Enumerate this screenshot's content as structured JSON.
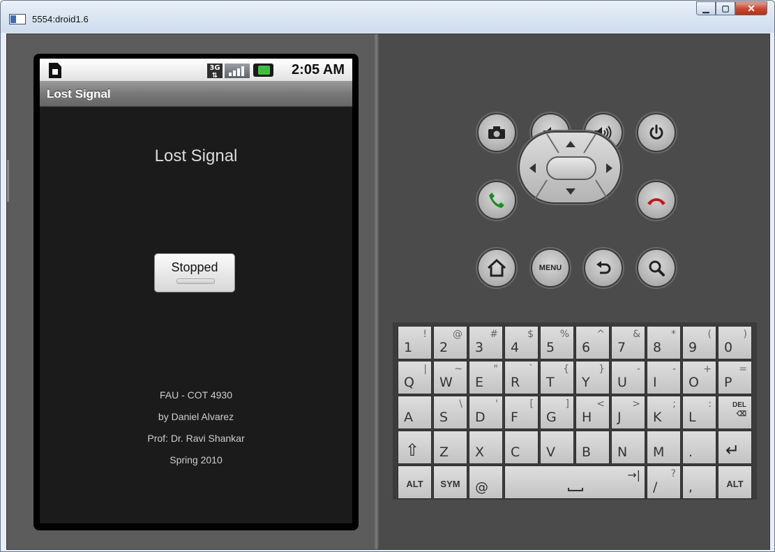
{
  "window": {
    "title": "5554:droid1.6",
    "min_glyph": "▁",
    "max_glyph": "▢",
    "close_glyph": "✕"
  },
  "status_bar": {
    "network": "3G",
    "time": "2:05 AM"
  },
  "app": {
    "bar_title": "Lost Signal",
    "heading": "Lost Signal",
    "toggle_label": "Stopped",
    "credits": [
      "FAU - COT 4930",
      "by Daniel Alvarez",
      "Prof: Dr. Ravi Shankar",
      "Spring 2010"
    ]
  },
  "controls": {
    "menu_label": "MENU",
    "icons": [
      "camera-icon",
      "volume-down-icon",
      "volume-up-icon",
      "power-icon",
      "call-icon",
      "end-call-icon",
      "home-icon",
      "back-icon",
      "search-icon"
    ]
  },
  "keyboard": {
    "rows": [
      [
        {
          "k": "1",
          "a": "!"
        },
        {
          "k": "2",
          "a": "@"
        },
        {
          "k": "3",
          "a": "#"
        },
        {
          "k": "4",
          "a": "$"
        },
        {
          "k": "5",
          "a": "%"
        },
        {
          "k": "6",
          "a": "^"
        },
        {
          "k": "7",
          "a": "&"
        },
        {
          "k": "8",
          "a": "*"
        },
        {
          "k": "9",
          "a": "("
        },
        {
          "k": "0",
          "a": ")"
        }
      ],
      [
        {
          "k": "Q",
          "a": "|"
        },
        {
          "k": "W",
          "a": "~"
        },
        {
          "k": "E",
          "a": "\""
        },
        {
          "k": "R",
          "a": "`"
        },
        {
          "k": "T",
          "a": "{"
        },
        {
          "k": "Y",
          "a": "}"
        },
        {
          "k": "U",
          "a": "-"
        },
        {
          "k": "I",
          "a": "-"
        },
        {
          "k": "O",
          "a": "+"
        },
        {
          "k": "P",
          "a": "="
        }
      ],
      [
        {
          "k": "A",
          "a": ""
        },
        {
          "k": "S",
          "a": "\\"
        },
        {
          "k": "D",
          "a": "'"
        },
        {
          "k": "F",
          "a": "["
        },
        {
          "k": "G",
          "a": "]"
        },
        {
          "k": "H",
          "a": "<"
        },
        {
          "k": "J",
          "a": ">"
        },
        {
          "k": "K",
          "a": ";"
        },
        {
          "k": "L",
          "a": ":"
        },
        {
          "k": "DEL",
          "a": ""
        }
      ],
      [
        {
          "k": "⇧",
          "a": ""
        },
        {
          "k": "Z",
          "a": ""
        },
        {
          "k": "X",
          "a": ""
        },
        {
          "k": "C",
          "a": ""
        },
        {
          "k": "V",
          "a": ""
        },
        {
          "k": "B",
          "a": ""
        },
        {
          "k": "N",
          "a": ""
        },
        {
          "k": "M",
          "a": ""
        },
        {
          "k": ".",
          "a": ""
        },
        {
          "k": "↵",
          "a": ""
        }
      ]
    ],
    "bottom": {
      "alt_left": "ALT",
      "sym": "SYM",
      "at": "@",
      "space_tab": "→|",
      "slash": "/",
      "slash_alt": "?",
      "comma": ",",
      "alt_right": "ALT"
    }
  }
}
